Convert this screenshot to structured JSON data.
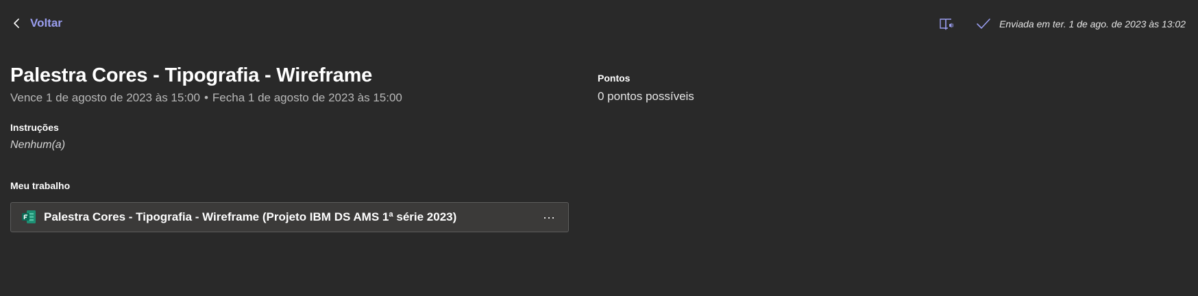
{
  "header": {
    "back_label": "Voltar",
    "back_icon": "chevron-left-icon",
    "reader_icon": "immersive-reader-icon",
    "status_icon": "checkmark-icon",
    "submitted_text": "Enviada em ter. 1 de ago. de 2023 às 13:02",
    "accent_color": "#9a9ef0"
  },
  "assignment": {
    "title": "Palestra Cores - Tipografia - Wireframe",
    "due": "Vence 1 de agosto de 2023 às 15:00",
    "separator": "•",
    "closes": "Fecha 1 de agosto de 2023 às 15:00"
  },
  "instructions": {
    "label": "Instruções",
    "value": "Nenhum(a)"
  },
  "work": {
    "label": "Meu trabalho",
    "items": [
      {
        "name": "Palestra Cores - Tipografia - Wireframe (Projeto IBM DS AMS 1ª série 2023)",
        "icon": "microsoft-forms-icon",
        "more_label": "···"
      }
    ]
  },
  "points": {
    "label": "Pontos",
    "value": "0 pontos possíveis"
  }
}
